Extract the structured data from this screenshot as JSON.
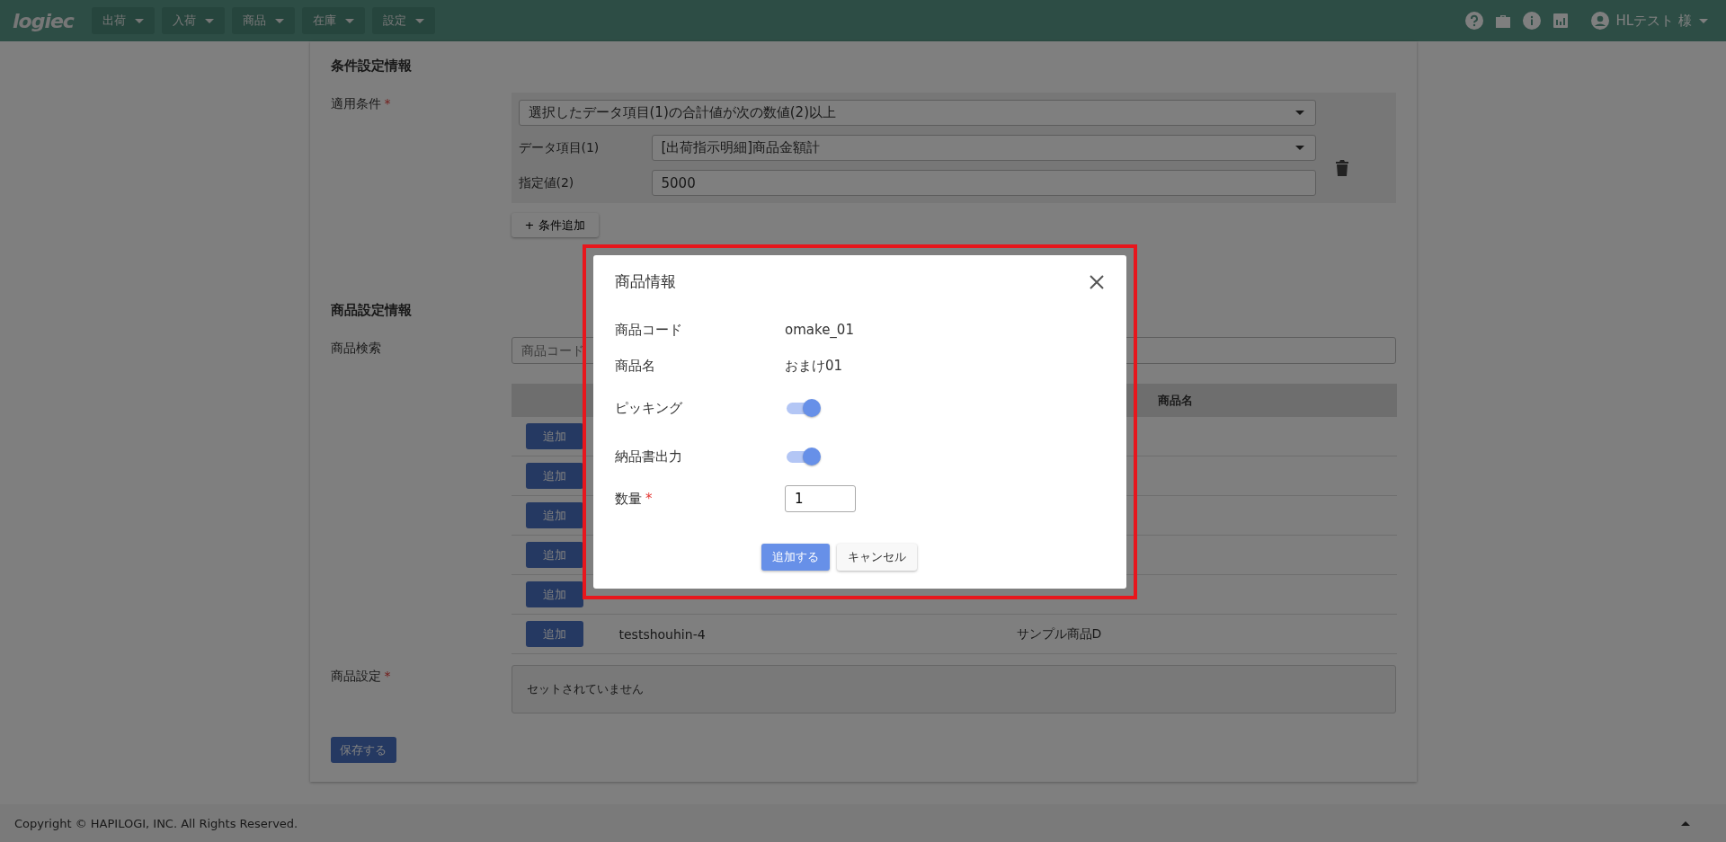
{
  "header": {
    "logo": "logiec",
    "menus": [
      {
        "label": "出荷"
      },
      {
        "label": "入荷"
      },
      {
        "label": "商品"
      },
      {
        "label": "在庫"
      },
      {
        "label": "設定"
      }
    ],
    "user": "HLテスト 様"
  },
  "conditions": {
    "title": "条件設定情報",
    "label": "適用条件",
    "required_mark": "*",
    "rule": "選択したデータ項目(1)の合計値が次の数値(2)以上",
    "item_label": "データ項目(1)",
    "item_value": "[出荷指示明細]商品金額計",
    "value_label": "指定値(2)",
    "value": "5000",
    "add_button": "+ 条件追加"
  },
  "products": {
    "title": "商品設定情報",
    "search_label": "商品検索",
    "search": {
      "placeholder": "商品コード"
    },
    "table": {
      "column_3": "商品名",
      "rows": [
        {
          "button": "追加"
        },
        {
          "button": "追加"
        },
        {
          "button": "追加"
        },
        {
          "button": "追加"
        },
        {
          "button": "追加"
        },
        {
          "button": "追加",
          "code": "testshouhin-4",
          "name": "サンプル商品D"
        }
      ]
    },
    "setting_label": "商品設定",
    "required_mark": "*",
    "setting_empty": "セットされていません",
    "save_button": "保存する"
  },
  "footer": {
    "copyright": "Copyright © HAPILOGI, INC. All Rights Reserved."
  },
  "modal": {
    "title": "商品情報",
    "fields": [
      {
        "kind": "text",
        "label": "商品コード",
        "value": "omake_01"
      },
      {
        "kind": "text",
        "label": "商品名",
        "value": "おまけ01"
      },
      {
        "kind": "switch",
        "label": "ピッキング",
        "on": true
      },
      {
        "kind": "switch",
        "label": "納品書出力",
        "on": true
      },
      {
        "kind": "input",
        "label": "数量",
        "required_mark": "*",
        "value": "1"
      }
    ],
    "buttons": [
      {
        "kind": "primary",
        "label": "追加する"
      },
      {
        "kind": "secondary",
        "label": "キャンセル"
      }
    ]
  }
}
